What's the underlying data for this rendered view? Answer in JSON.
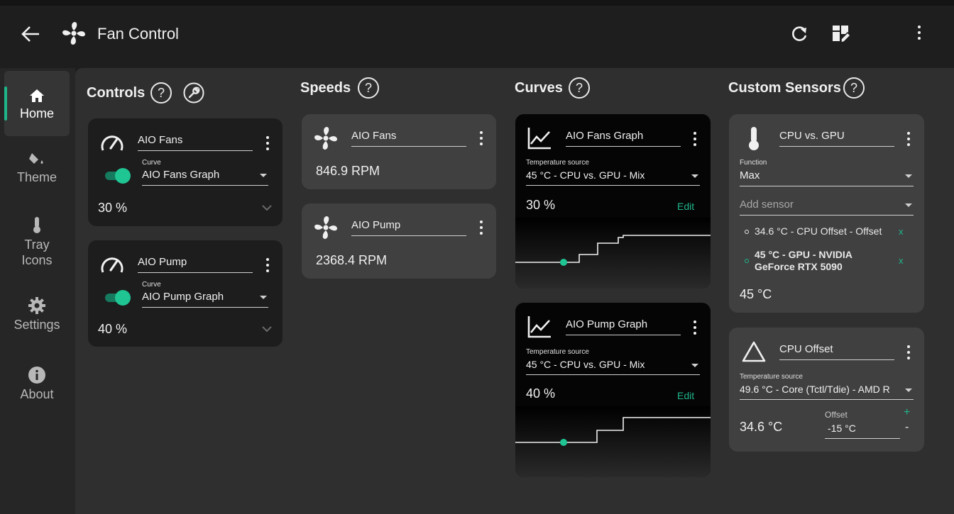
{
  "app": {
    "title": "Fan Control"
  },
  "sidebar": {
    "items": [
      {
        "label": "Home",
        "icon": "home-icon"
      },
      {
        "label": "Theme",
        "icon": "paint-bucket-icon"
      },
      {
        "label": "Tray\nIcons",
        "icon": "thermometer-icon"
      },
      {
        "label": "Settings",
        "icon": "gear-icon"
      },
      {
        "label": "About",
        "icon": "info-icon"
      }
    ]
  },
  "sections": {
    "controls": "Controls",
    "speeds": "Speeds",
    "curves": "Curves",
    "custom_sensors": "Custom Sensors",
    "help": "?"
  },
  "controls": [
    {
      "name": "AIO Fans",
      "curve_label": "Curve",
      "curve": "AIO Fans Graph",
      "value": "30 %"
    },
    {
      "name": "AIO Pump",
      "curve_label": "Curve",
      "curve": "AIO Pump Graph",
      "value": "40 %"
    }
  ],
  "speeds": [
    {
      "name": "AIO Fans",
      "value": "846.9 RPM"
    },
    {
      "name": "AIO Pump",
      "value": "2368.4 RPM"
    }
  ],
  "curves": [
    {
      "name": "AIO Fans Graph",
      "source_label": "Temperature source",
      "source": "45 °C - CPU vs. GPU - Mix",
      "value": "30 %",
      "edit": "Edit"
    },
    {
      "name": "AIO Pump Graph",
      "source_label": "Temperature source",
      "source": "45 °C - CPU vs. GPU - Mix",
      "value": "40 %",
      "edit": "Edit"
    }
  ],
  "custom_sensors": {
    "cpu_vs_gpu": {
      "name": "CPU vs. GPU",
      "function_label": "Function",
      "function": "Max",
      "add_placeholder": "Add sensor",
      "sensors": [
        {
          "text": "34.6 °C - CPU Offset - Offset",
          "remove": "x"
        },
        {
          "text_line1": "45 °C - GPU - NVIDIA",
          "text_line2": "GeForce RTX 5090",
          "remove": "x"
        }
      ],
      "value": "45 °C"
    },
    "cpu_offset": {
      "name": "CPU Offset",
      "source_label": "Temperature source",
      "source": "49.6 °C - Core (Tctl/Tdie) - AMD R",
      "value": "34.6 °C",
      "offset_label": "Offset",
      "offset": "-15 °C",
      "plus": "+",
      "minus": "-"
    }
  },
  "colors": {
    "accent": "#1fb58a",
    "background": "#1e1e1e",
    "panel": "#2f2f2f",
    "card_dark": "#1d1d1d",
    "card_light": "#404040"
  }
}
